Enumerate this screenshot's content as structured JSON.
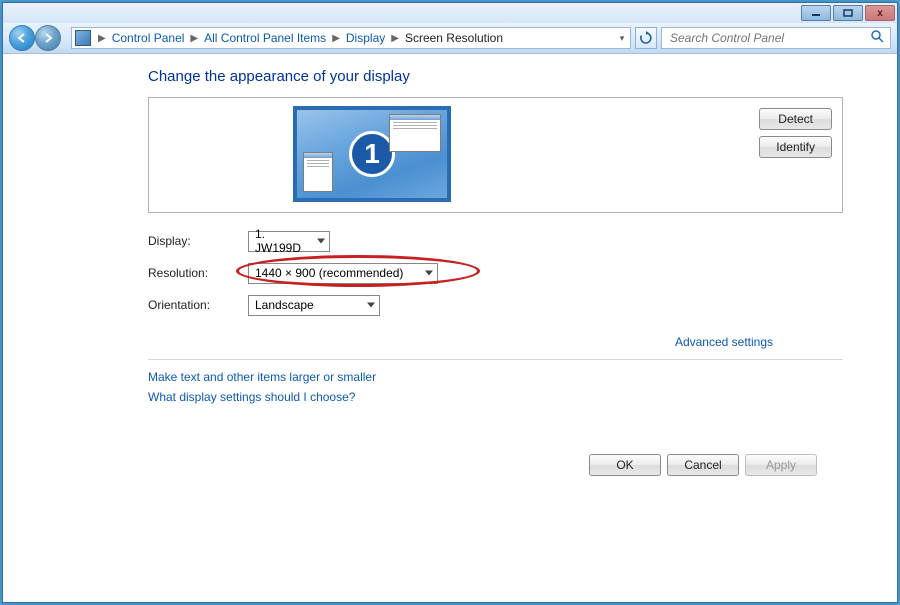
{
  "breadcrumbs": [
    "Control Panel",
    "All Control Panel Items",
    "Display",
    "Screen Resolution"
  ],
  "search": {
    "placeholder": "Search Control Panel"
  },
  "page": {
    "title": "Change the appearance of your display",
    "monitor_number": "1"
  },
  "preview_buttons": {
    "detect": "Detect",
    "identify": "Identify"
  },
  "form": {
    "display_label": "Display:",
    "display_value": "1. JW199D",
    "resolution_label": "Resolution:",
    "resolution_value": "1440 × 900 (recommended)",
    "orientation_label": "Orientation:",
    "orientation_value": "Landscape"
  },
  "links": {
    "advanced": "Advanced settings",
    "larger_text": "Make text and other items larger or smaller",
    "help": "What display settings should I choose?"
  },
  "dialog_buttons": {
    "ok": "OK",
    "cancel": "Cancel",
    "apply": "Apply"
  }
}
